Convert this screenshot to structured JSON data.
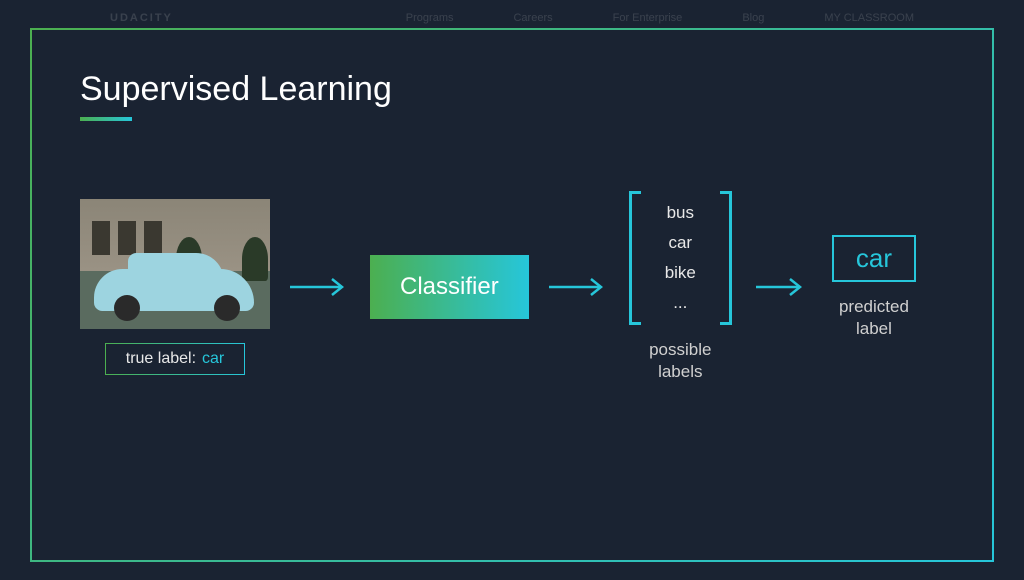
{
  "nav": {
    "logo": "UDACITY",
    "items": [
      "Programs",
      "Careers",
      "For Enterprise",
      "Blog",
      "MY CLASSROOM"
    ]
  },
  "slide": {
    "title": "Supervised Learning"
  },
  "input": {
    "true_label_prefix": "true label:",
    "true_label_value": "car"
  },
  "classifier": {
    "label": "Classifier"
  },
  "possible_labels": {
    "items": [
      "bus",
      "car",
      "bike",
      "..."
    ],
    "caption": "possible\nlabels"
  },
  "prediction": {
    "value": "car",
    "caption": "predicted\nlabel"
  },
  "colors": {
    "gradient_start": "#4caf50",
    "gradient_end": "#26c6da",
    "bg": "#1a2332"
  }
}
